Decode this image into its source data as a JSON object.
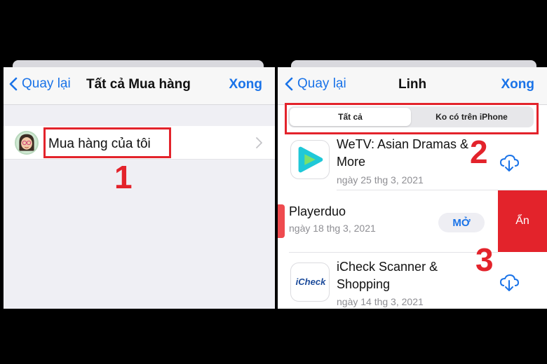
{
  "left_screen": {
    "back_label": "Quay lại",
    "title": "Tất cả Mua hàng",
    "done_label": "Xong",
    "row_label": "Mua hàng của tôi",
    "step": "1"
  },
  "right_screen": {
    "back_label": "Quay lại",
    "title": "Linh",
    "done_label": "Xong",
    "segments": [
      "Tất cả",
      "Ko có trên iPhone"
    ],
    "active_segment": "Tất cả",
    "step_segments": "2",
    "step_hide": "3",
    "apps": [
      {
        "name": "WeTV: Asian Dramas & More",
        "date": "ngày 25 thg 3, 2021",
        "action": "download-icon"
      },
      {
        "name": "Playerduo",
        "date": "ngày 18 thg 3, 2021",
        "action": "MỞ"
      },
      {
        "name": "iCheck Scanner & Shopping",
        "date": "ngày 14 thg 3, 2021",
        "action": "download-icon"
      }
    ],
    "icheck_logo_text": "iCheck",
    "hide_label": "Ẩn"
  },
  "colors": {
    "accent": "#1a73e8",
    "highlight": "#e3232b",
    "background": "#000000"
  }
}
